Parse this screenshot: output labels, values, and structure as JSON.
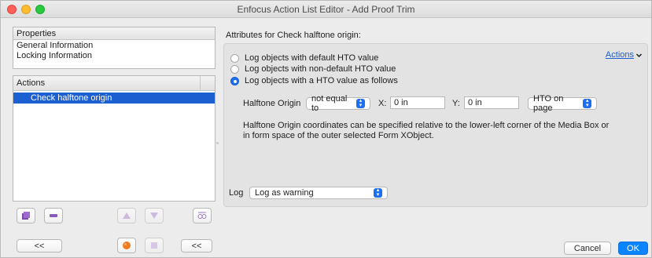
{
  "window": {
    "title": "Enfocus Action List Editor - Add Proof Trim"
  },
  "properties": {
    "header": "Properties",
    "items": [
      "General Information",
      "Locking Information"
    ]
  },
  "actions_panel": {
    "header": "Actions",
    "rows": [
      {
        "label": "Check halftone origin",
        "selected": true
      }
    ]
  },
  "left_toolbar": {
    "collapse_label_1": "<<",
    "collapse_label_2": "<<"
  },
  "attributes": {
    "title": "Attributes for Check halftone origin:",
    "actions_menu": "Actions",
    "radios": [
      {
        "label": "Log objects with default HTO value",
        "checked": false
      },
      {
        "label": "Log objects with non-default HTO value",
        "checked": false
      },
      {
        "label": "Log objects with a HTO value as follows",
        "checked": true
      }
    ],
    "halftone_origin_label": "Halftone Origin",
    "comparison_value": "not equal to",
    "x_label": "X:",
    "x_value": "0 in",
    "y_label": "Y:",
    "y_value": "0 in",
    "hto_value": "HTO on page",
    "description": "Halftone Origin coordinates can be specified relative to the lower-left corner of the Media Box or in form space of the outer selected Form XObject."
  },
  "log": {
    "label": "Log",
    "value": "Log as warning"
  },
  "footer": {
    "cancel": "Cancel",
    "ok": "OK"
  },
  "colors": {
    "accent": "#1b5fd1",
    "primary_button": "#0a84ff"
  }
}
